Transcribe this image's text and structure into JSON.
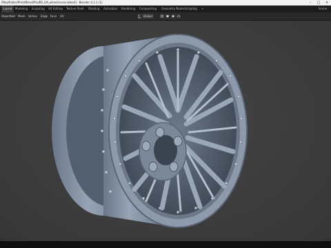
{
  "window": {
    "title": "/files/folder/Print/Blend/Pro/BS_LM_wheel/scene.blend] - Blender 4.1.1 (1)",
    "minimize_label": "–",
    "maximize_label": "□",
    "close_label": "×"
  },
  "workspace_tabs": [
    {
      "label": "Layout",
      "active": true
    },
    {
      "label": "Modeling"
    },
    {
      "label": "Sculpting"
    },
    {
      "label": "UV Editing"
    },
    {
      "label": "Texture Paint"
    },
    {
      "label": "Shading"
    },
    {
      "label": "Animation"
    },
    {
      "label": "Rendering"
    },
    {
      "label": "Compositing"
    },
    {
      "label": "Geometry Nodes"
    },
    {
      "label": "Scripting"
    },
    {
      "label": "+"
    }
  ],
  "scene_label": "Scene",
  "header_menu": [
    "Object",
    "Add",
    "Mesh",
    "Vertex",
    "Edge",
    "Face",
    "UV"
  ],
  "transform": {
    "orientation": "Global"
  },
  "colors": {
    "viewport_bg": "#3d3d3d",
    "wheel_metal": "#8795a6",
    "title_bar": "#f2f2f2",
    "topbar": "#1c1c1c"
  }
}
